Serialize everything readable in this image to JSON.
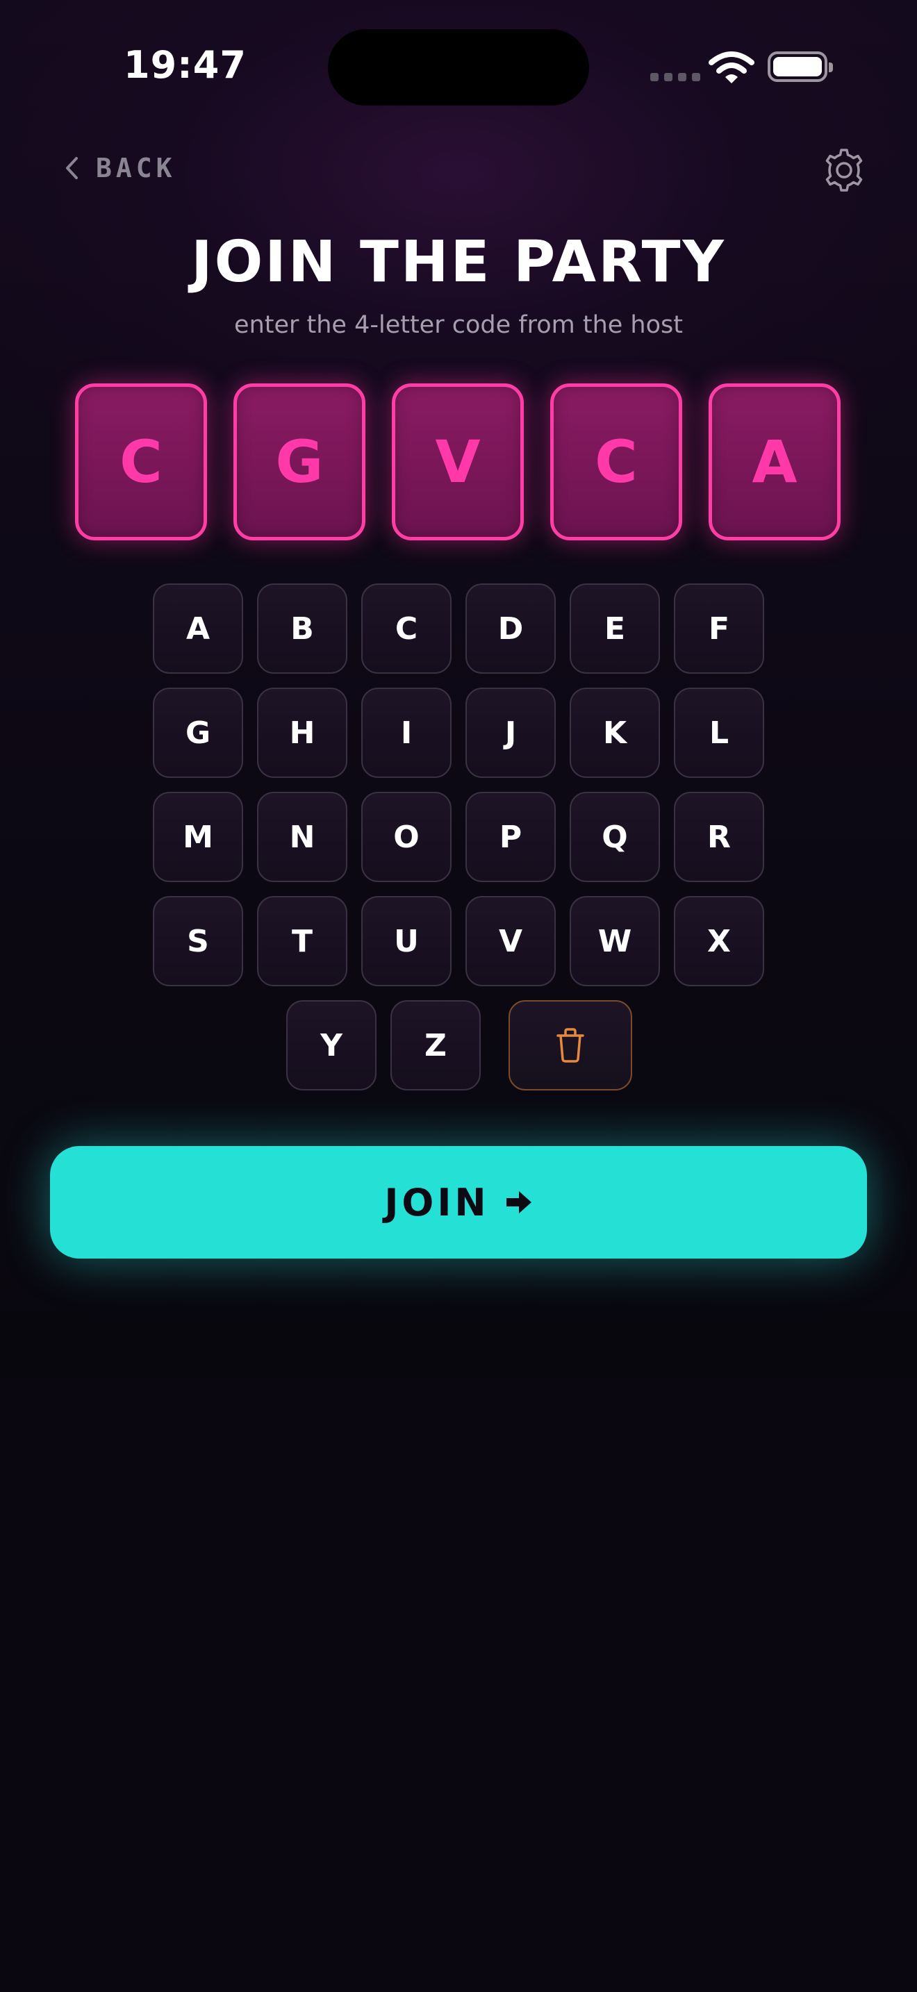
{
  "status_bar": {
    "time": "19:47"
  },
  "nav": {
    "back_label": "BACK"
  },
  "header": {
    "title": "JOIN THE PARTY",
    "subtitle": "enter the 4-letter code from the host"
  },
  "code": [
    "C",
    "G",
    "V",
    "C",
    "A"
  ],
  "keyboard": {
    "rows": [
      [
        "A",
        "B",
        "C",
        "D",
        "E",
        "F"
      ],
      [
        "G",
        "H",
        "I",
        "J",
        "K",
        "L"
      ],
      [
        "M",
        "N",
        "O",
        "P",
        "Q",
        "R"
      ],
      [
        "S",
        "T",
        "U",
        "V",
        "W",
        "X"
      ],
      [
        "Y",
        "Z"
      ]
    ]
  },
  "join_button": {
    "label": "JOIN"
  },
  "colors": {
    "accent_pink": "#ff3ea5",
    "accent_teal": "#25e0d4",
    "delete_orange": "#e58a3c",
    "background": "#0a0710"
  },
  "icons": {
    "back": "chevron-left-icon",
    "settings": "gear-icon",
    "delete": "trash-icon",
    "join": "arrow-right-icon",
    "wifi": "wifi-icon",
    "battery": "battery-icon",
    "signal": "signal-icon"
  }
}
